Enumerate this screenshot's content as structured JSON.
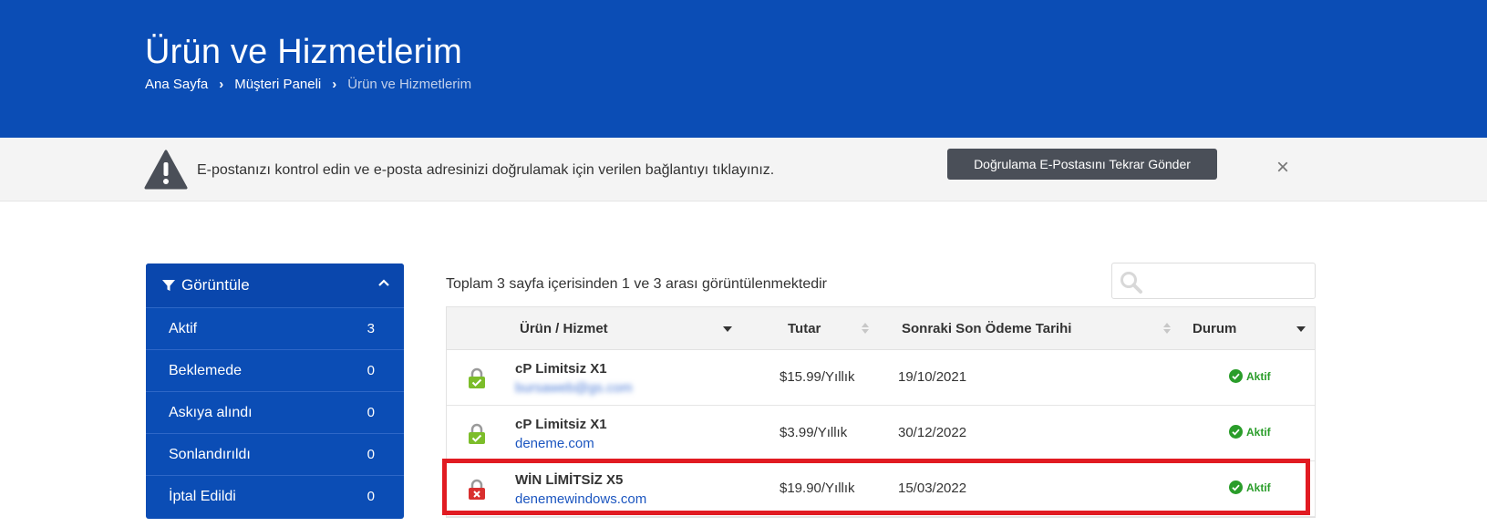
{
  "header": {
    "title": "Ürün ve Hizmetlerim",
    "breadcrumb": [
      "Ana Sayfa",
      "Müşteri Paneli",
      "Ürün ve Hizmetlerim"
    ]
  },
  "alert": {
    "message": "E-postanızı kontrol edin ve e-posta adresinizi doğrulamak için verilen bağlantıyı tıklayınız.",
    "button_label": "Doğrulama E-Postasını Tekrar Gönder",
    "close_label": "×"
  },
  "sidebar": {
    "title": "Görüntüle",
    "items": [
      {
        "label": "Aktif",
        "count": "3"
      },
      {
        "label": "Beklemede",
        "count": "0"
      },
      {
        "label": "Askıya alındı",
        "count": "0"
      },
      {
        "label": "Sonlandırıldı",
        "count": "0"
      },
      {
        "label": "İptal Edildi",
        "count": "0"
      }
    ]
  },
  "summary": "Toplam 3 sayfa içerisinden 1 ve 3 arası görüntülenmektedir",
  "table": {
    "columns": [
      "Ürün / Hizmet",
      "Tutar",
      "Sonraki Son Ödeme Tarihi",
      "Durum"
    ],
    "rows": [
      {
        "product": "cP Limitsiz X1",
        "domain": "bursaweb@gs.com",
        "price": "$15.99/Yıllık",
        "due": "19/10/2021",
        "status": "Aktif",
        "lock": "green"
      },
      {
        "product": "cP Limitsiz X1",
        "domain": "deneme.com",
        "price": "$3.99/Yıllık",
        "due": "30/12/2022",
        "status": "Aktif",
        "lock": "green"
      },
      {
        "product": "WİN LİMİTSİZ X5",
        "domain": "denemewindows.com",
        "price": "$19.90/Yıllık",
        "due": "15/03/2022",
        "status": "Aktif",
        "lock": "red"
      }
    ]
  },
  "colors": {
    "primary": "#0b4db5",
    "active_status": "#2a9d2a",
    "highlight": "#e11b22"
  }
}
